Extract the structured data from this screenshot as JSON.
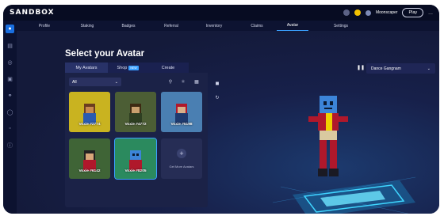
{
  "app": {
    "logo": "SANDBOX"
  },
  "topbar": {
    "username": "Moonscaper",
    "play_label": "Play",
    "more_label": "..."
  },
  "nav": {
    "items": [
      {
        "label": "Profile",
        "active": false
      },
      {
        "label": "Staking",
        "active": false
      },
      {
        "label": "Badges",
        "active": false
      },
      {
        "label": "Referral",
        "active": false
      },
      {
        "label": "Inventory",
        "active": false
      },
      {
        "label": "Claims",
        "active": false
      },
      {
        "label": "Avatar",
        "active": true
      },
      {
        "label": "Settings",
        "active": false
      }
    ]
  },
  "sidebar": {
    "icons": [
      "user-icon",
      "inventory-icon",
      "globe-icon",
      "controller-icon",
      "bulb-icon",
      "coin-icon",
      "chat-icon",
      "info-icon"
    ]
  },
  "page": {
    "title": "Select your Avatar"
  },
  "tabs": [
    {
      "label": "My Avatars",
      "active": true
    },
    {
      "label": "Shop",
      "badge": "NEW",
      "active": false
    },
    {
      "label": "Create",
      "active": false
    }
  ],
  "filter": {
    "selected": "All"
  },
  "avatars": [
    {
      "label": "Voxie #2774",
      "bg": "#c9b320"
    },
    {
      "label": "Voxie #4772",
      "bg": "#4c5e35"
    },
    {
      "label": "Voxie #5198",
      "bg": "#4a7fb2"
    },
    {
      "label": "Voxie #6142",
      "bg": "#3f6436"
    },
    {
      "label": "Voxie #8205",
      "bg": "#2b8a5e",
      "selected": true
    }
  ],
  "add_card": {
    "label": "Get More Avatars"
  },
  "animation": {
    "selected": "Dance Gangnam"
  },
  "colors": {
    "accent": "#3aa0ff",
    "panel": "#1b2247",
    "background": "#141a3a"
  }
}
